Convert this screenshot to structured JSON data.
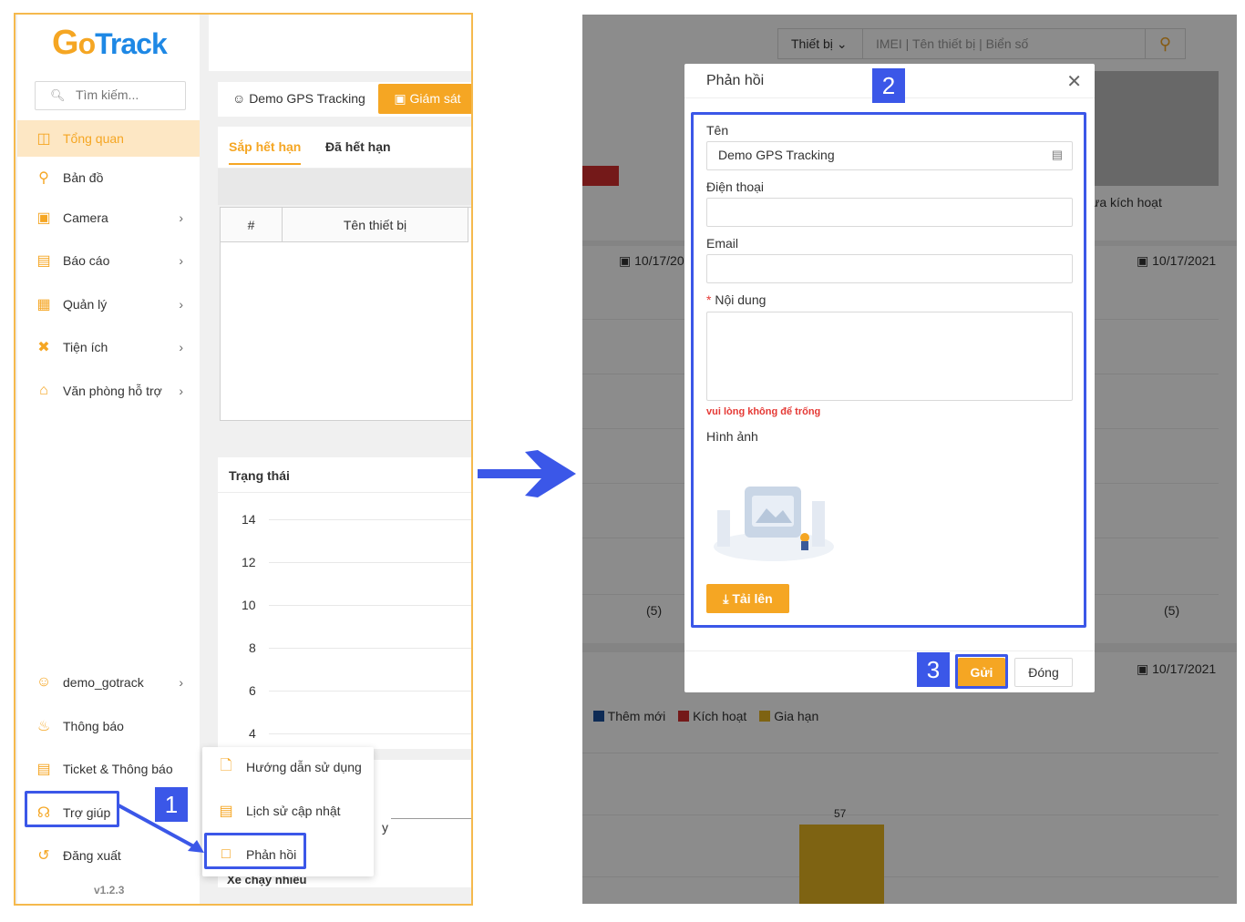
{
  "left": {
    "logo": {
      "g": "G",
      "o": "o",
      "t": "Track"
    },
    "search_placeholder": "Tìm kiếm...",
    "menu": [
      {
        "label": "Tổng quan",
        "icon": "dashboard-icon"
      },
      {
        "label": "Bản đồ",
        "icon": "map-icon"
      },
      {
        "label": "Camera",
        "icon": "camera-icon"
      },
      {
        "label": "Báo cáo",
        "icon": "report-icon"
      },
      {
        "label": "Quản lý",
        "icon": "grid-icon"
      },
      {
        "label": "Tiện ích",
        "icon": "tools-icon"
      },
      {
        "label": "Văn phòng hỗ trợ",
        "icon": "store-icon"
      }
    ],
    "bottom_menu": [
      {
        "label": "demo_gotrack",
        "icon": "user-icon"
      },
      {
        "label": "Thông báo",
        "icon": "bell-icon"
      },
      {
        "label": "Ticket & Thông báo",
        "icon": "ticket-icon"
      },
      {
        "label": "Trợ giúp",
        "icon": "headset-icon"
      },
      {
        "label": "Đăng xuất",
        "icon": "logout-icon"
      }
    ],
    "version": "v1.2.3",
    "user_name": "Demo GPS Tracking",
    "monitor_button": "Giám sát",
    "tabs": [
      "Sắp hết hạn",
      "Đã hết hạn"
    ],
    "table_headers": [
      "#",
      "Tên thiết bị"
    ],
    "status_title": "Trạng thái",
    "y_ticks": [
      "14",
      "12",
      "10",
      "8",
      "6",
      "4"
    ],
    "bottom_card_title": "Xe chạy nhiều",
    "bottom_card_partial": "y",
    "submenu": [
      {
        "label": "Hướng dẫn sử dụng",
        "icon": "document-icon"
      },
      {
        "label": "Lịch sử cập nhật",
        "icon": "history-icon"
      },
      {
        "label": "Phản hồi",
        "icon": "chat-icon"
      }
    ]
  },
  "right": {
    "device_select": "Thiết bị",
    "search_placeholder": "IMEI | Tên thiết bị | Biển số",
    "bg_texts": {
      "date_left": "10/17/20",
      "date_right_1": "10/17/2021",
      "date_right_2": "10/17/2021",
      "not_activated": "ưa kích hoạt",
      "count_left": "(5)",
      "count_right": "(5)",
      "bar_value": "57"
    },
    "legend": [
      {
        "label": "Thêm mới",
        "color": "#1a4f9c"
      },
      {
        "label": "Kích hoạt",
        "color": "#d32f2f"
      },
      {
        "label": "Gia hạn",
        "color": "#e6b422"
      }
    ],
    "modal": {
      "title": "Phản hồi",
      "name_label": "Tên",
      "name_value": "Demo GPS Tracking",
      "phone_label": "Điện thoại",
      "email_label": "Email",
      "content_required": "*",
      "content_label": "Nội dung",
      "error": "vui lòng không để trống",
      "image_label": "Hình ảnh",
      "upload_button": "Tải lên",
      "send_button": "Gửi",
      "close_button": "Đóng"
    }
  },
  "callouts": [
    "1",
    "2",
    "3"
  ],
  "colors": {
    "accent": "#f5a623",
    "callout": "#3b57e8",
    "brand_blue": "#1e88e5"
  }
}
